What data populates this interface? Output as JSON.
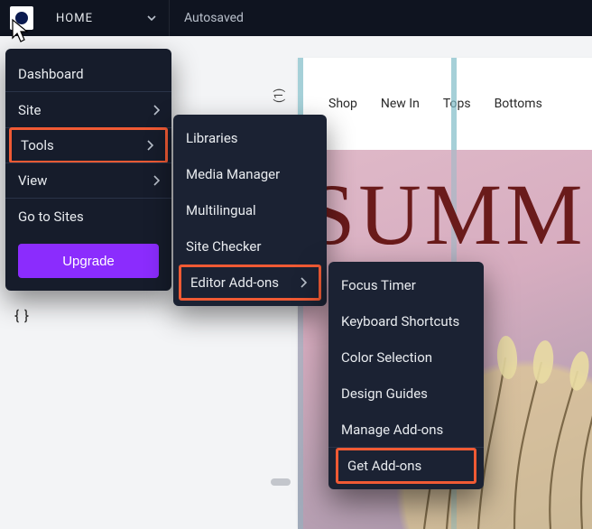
{
  "topbar": {
    "home_label": "HOME",
    "autosave_label": "Autosaved"
  },
  "rotated_label": "(1)",
  "menu1": {
    "dashboard": "Dashboard",
    "site": "Site",
    "tools": "Tools",
    "view": "View",
    "go_to_sites": "Go to Sites",
    "upgrade": "Upgrade"
  },
  "menu2": {
    "libraries": "Libraries",
    "media_manager": "Media Manager",
    "multilingual": "Multilingual",
    "site_checker": "Site Checker",
    "editor_addons": "Editor Add-ons"
  },
  "menu3": {
    "focus_timer": "Focus Timer",
    "keyboard_shortcuts": "Keyboard Shortcuts",
    "color_selection": "Color Selection",
    "design_guides": "Design Guides",
    "manage_addons": "Manage Add-ons",
    "get_addons": "Get Add-ons"
  },
  "canvas": {
    "nav": {
      "shop": "Shop",
      "new_in": "New In",
      "tops": "Tops",
      "bottoms": "Bottoms"
    },
    "hero_title": "SUMM"
  },
  "highlights": {
    "menu1_highlighted": "tools",
    "menu2_highlighted": "editor_addons",
    "menu3_highlighted": "get_addons"
  },
  "colors": {
    "accent_purple": "#8b2cfd",
    "highlight_orange": "#f05a34",
    "panel_dark": "#161c2b"
  }
}
